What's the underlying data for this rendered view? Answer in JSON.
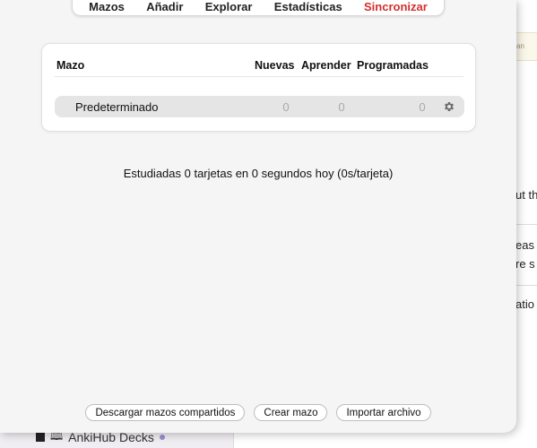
{
  "toolbar": {
    "decks": "Mazos",
    "add": "Añadir",
    "browse": "Explorar",
    "stats": "Estadísticas",
    "sync": "Sincronizar"
  },
  "deck_table": {
    "headers": {
      "deck": "Mazo",
      "new": "Nuevas",
      "learn": "Aprender",
      "due": "Programadas"
    },
    "rows": [
      {
        "name": "Predeterminado",
        "new": "0",
        "learn": "0",
        "due": "0"
      }
    ]
  },
  "stats_text": "Estudiadas 0 tarjetas en 0 segundos hoy (0s/tarjeta)",
  "bottom_buttons": {
    "get_shared": "Descargar mazos compartidos",
    "create_deck": "Crear mazo",
    "import_file": "Importar archivo"
  },
  "background": {
    "note_fragment": "guaran",
    "text_fragments": [
      "ut th",
      "eas",
      "re s",
      "atio"
    ],
    "sidebar_item": "AnkiHub Decks"
  },
  "colors": {
    "sync_accent": "#d32f2f",
    "muted_count": "#a8a8a8"
  }
}
